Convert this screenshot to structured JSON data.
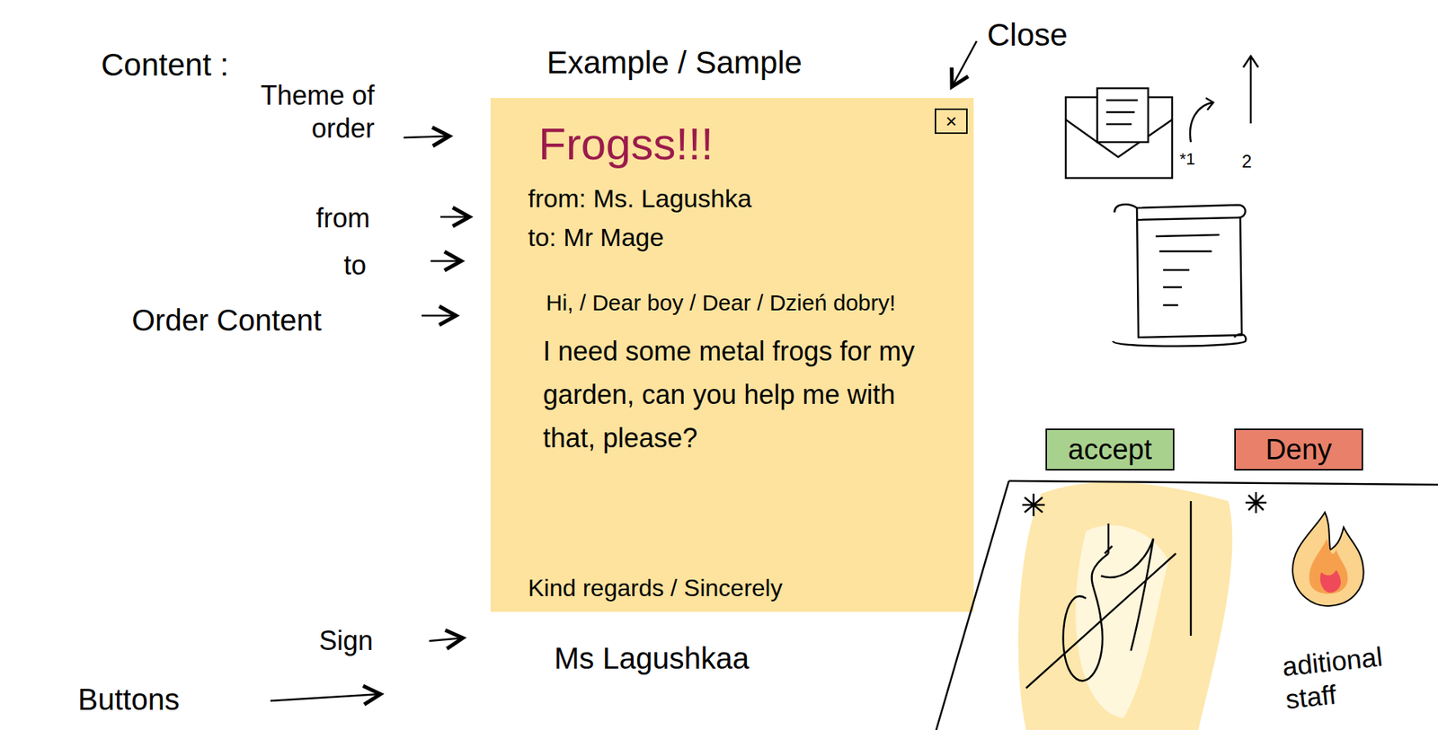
{
  "annotations": {
    "heading": "Content :",
    "sample_heading": "Example / Sample",
    "close_label": "Close",
    "labels": [
      {
        "text": "Theme of order"
      },
      {
        "text": "from"
      },
      {
        "text": "to"
      },
      {
        "text": "Order Content"
      },
      {
        "text": "Sign"
      },
      {
        "text": "Buttons"
      }
    ]
  },
  "letter": {
    "theme": "Frogss!!!",
    "from": "from: Ms. Lagushka",
    "to": "to: Mr Mage",
    "greeting": "Hi, / Dear boy / Dear / Dzień dobry!",
    "body": "I need some metal frogs for my garden, can you help me with that, please?",
    "closing": "Kind regards / Sincerely",
    "signature": "Ms Lagushkaa",
    "close_button": "×"
  },
  "icon_notes": [
    "*1",
    "2"
  ],
  "buttons": [
    {
      "label": "accept",
      "color": "#a9d18e"
    },
    {
      "label": "Deny",
      "color": "#e8806a"
    }
  ],
  "extra_note": "aditional staff"
}
